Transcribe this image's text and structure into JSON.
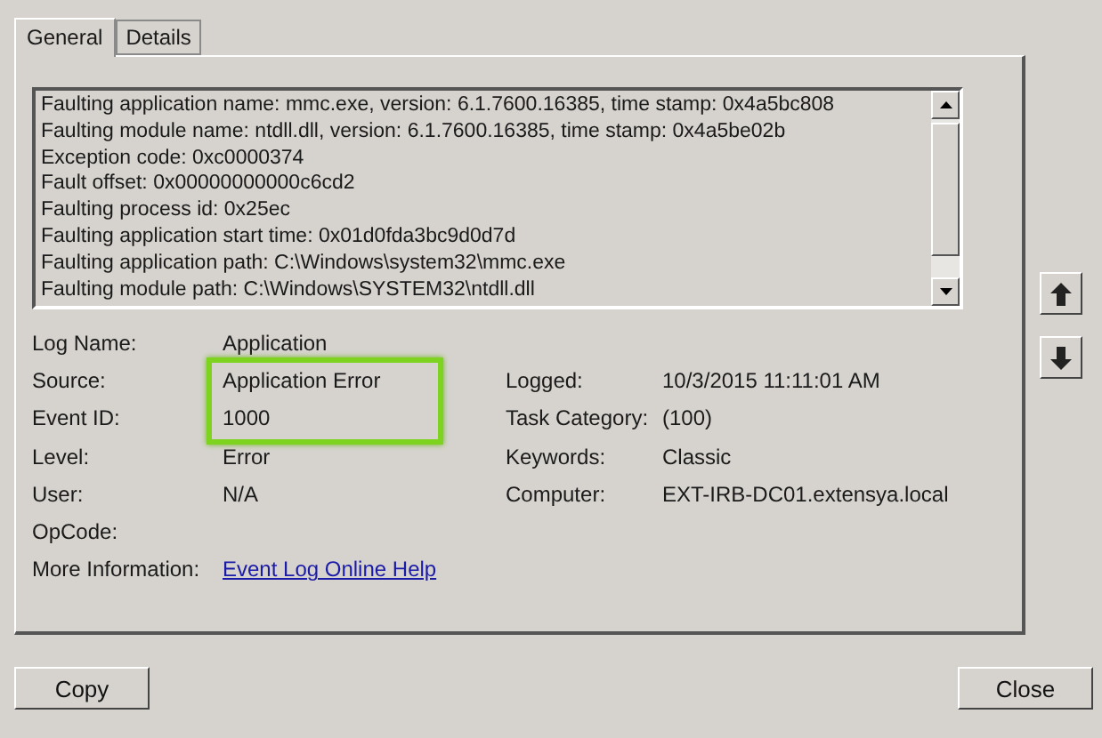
{
  "tabs": [
    {
      "label": "General",
      "selected": true
    },
    {
      "label": "Details",
      "selected": false
    }
  ],
  "description_lines": [
    "Faulting application name: mmc.exe, version: 6.1.7600.16385, time stamp: 0x4a5bc808",
    "Faulting module name: ntdll.dll, version: 6.1.7600.16385, time stamp: 0x4a5be02b",
    "Exception code: 0xc0000374",
    "Fault offset: 0x00000000000c6cd2",
    "Faulting process id: 0x25ec",
    "Faulting application start time: 0x01d0fda3bc9d0d7d",
    "Faulting application path: C:\\Windows\\system32\\mmc.exe",
    "Faulting module path: C:\\Windows\\SYSTEM32\\ntdll.dll"
  ],
  "rows": [
    {
      "kind": "field",
      "label": "Log Name:",
      "value": "Application"
    },
    {
      "kind": "field",
      "label": "Source:",
      "value": "Application Error",
      "highlighted": true,
      "right": {
        "label": "Logged:",
        "value": "10/3/2015 11:11:01 AM"
      }
    },
    {
      "kind": "field",
      "label": "Event ID:",
      "value": "1000",
      "highlighted": true,
      "right": {
        "label": "Task Category:",
        "value": "(100)"
      }
    },
    {
      "kind": "field",
      "label": "Level:",
      "value": "Error",
      "right": {
        "label": "Keywords:",
        "value": "Classic"
      }
    },
    {
      "kind": "field",
      "label": "User:",
      "value": "N/A",
      "right": {
        "label": "Computer:",
        "value": "EXT-IRB-DC01.extensya.local"
      }
    },
    {
      "kind": "field",
      "label": "OpCode:"
    },
    {
      "kind": "link",
      "label": "More Information:",
      "value": "Event Log Online Help"
    }
  ],
  "buttons": [
    {
      "label": "Copy"
    },
    {
      "label": "Close"
    }
  ]
}
